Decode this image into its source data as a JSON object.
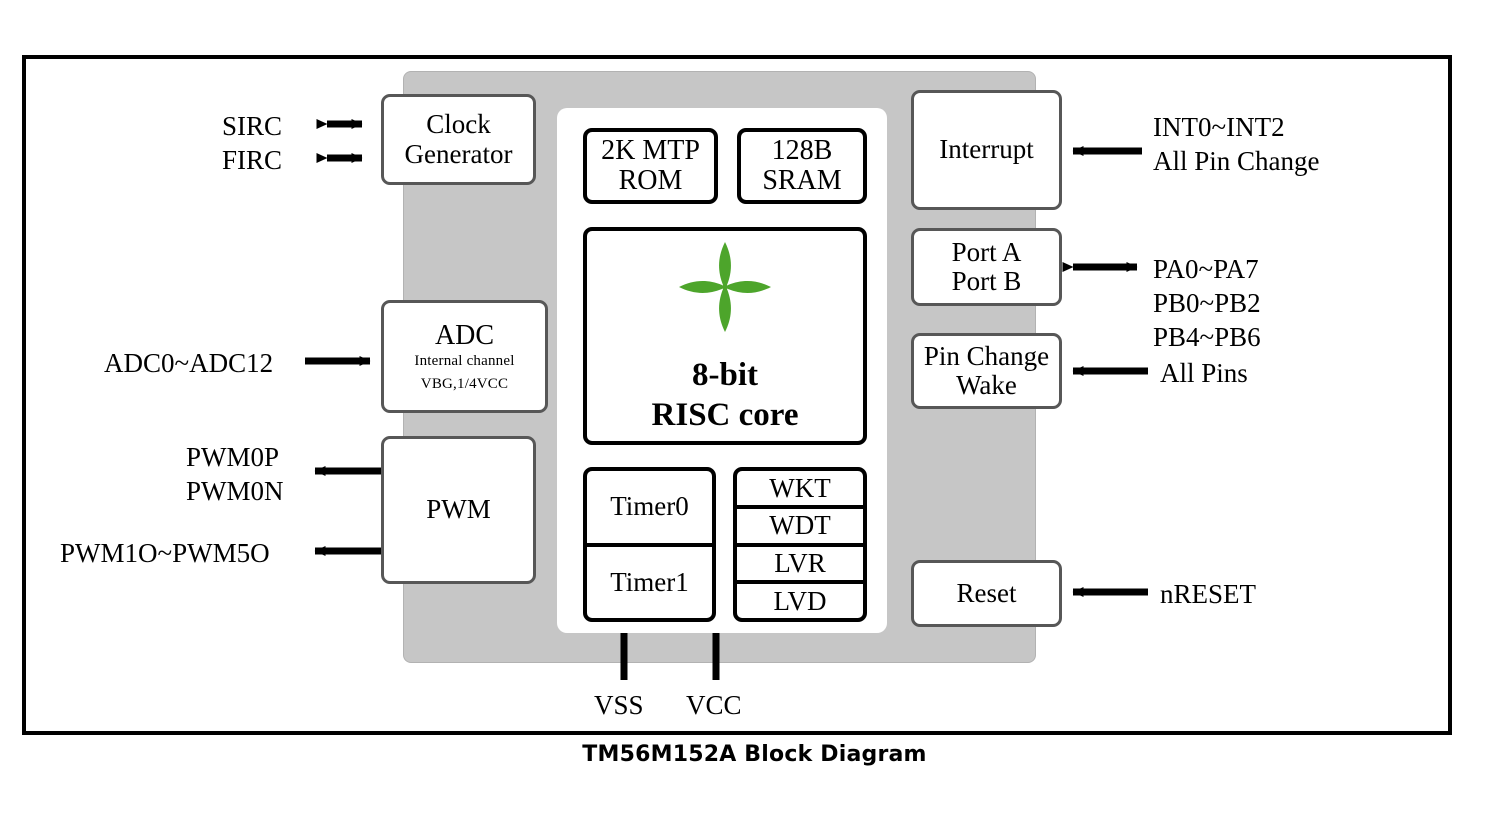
{
  "caption": "TM56M152A Block Diagram",
  "chip": {
    "body_color": "#c6c6c6",
    "inner_panel_color": "#ffffff"
  },
  "left_blocks": [
    {
      "id": "clock",
      "lines": [
        "Clock",
        "Generator"
      ]
    },
    {
      "id": "adc",
      "title": "ADC",
      "sub1": "Internal channel",
      "sub2": "VBG,1/4VCC"
    },
    {
      "id": "pwm",
      "lines": [
        "PWM"
      ]
    }
  ],
  "left_labels": [
    {
      "id": "sirc",
      "text": "SIRC",
      "arrow": "bidirectional"
    },
    {
      "id": "firc",
      "text": "FIRC",
      "arrow": "bidirectional"
    },
    {
      "id": "adc_pins",
      "text": "ADC0~ADC12",
      "arrow": "into-block"
    },
    {
      "id": "pwm0",
      "line1": "PWM0P",
      "line2": "PWM0N",
      "arrow": "out-of-block"
    },
    {
      "id": "pwm1_5",
      "text": "PWM1O~PWM5O",
      "arrow": "out-of-block"
    }
  ],
  "right_blocks": [
    {
      "id": "interrupt",
      "lines": [
        "Interrupt"
      ]
    },
    {
      "id": "ports",
      "lines": [
        "Port A",
        "Port B"
      ]
    },
    {
      "id": "pinchange",
      "lines": [
        "Pin Change",
        "Wake"
      ]
    },
    {
      "id": "reset",
      "lines": [
        "Reset"
      ]
    }
  ],
  "right_labels": [
    {
      "id": "int_pins",
      "line1": "INT0~INT2",
      "line2": "All Pin Change",
      "arrow": "into-block"
    },
    {
      "id": "port_pins",
      "line1": "PA0~PA7",
      "line2": "PB0~PB2",
      "line3": "PB4~PB6",
      "arrow": "bidirectional"
    },
    {
      "id": "all_pins",
      "text": "All Pins",
      "arrow": "into-block"
    },
    {
      "id": "nreset",
      "text": "nRESET",
      "arrow": "into-block"
    }
  ],
  "center_blocks": {
    "mtp_rom": {
      "line1": "2K MTP",
      "line2": "ROM"
    },
    "sram": {
      "line1": "128B",
      "line2": "SRAM"
    },
    "core": {
      "logo": "pinwheel-logo",
      "logo_color": "#4da52b",
      "line1": "8-bit",
      "line2": "RISC core"
    },
    "timers": [
      "Timer0",
      "Timer1"
    ],
    "watchdogs": [
      "WKT",
      "WDT",
      "LVR",
      "LVD"
    ]
  },
  "power_pins": [
    {
      "id": "vss",
      "text": "VSS"
    },
    {
      "id": "vcc",
      "text": "VCC"
    }
  ],
  "colors": {
    "chip_gray": "#c6c6c6",
    "block_border": "#575757",
    "heavy_border": "#000000",
    "logo_green": "#4da52b",
    "frame": "#000000"
  }
}
